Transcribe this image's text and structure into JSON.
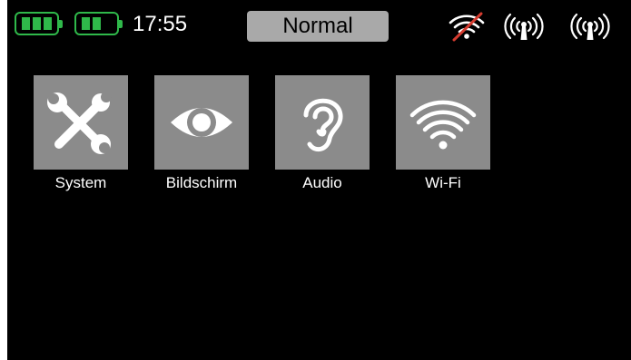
{
  "status": {
    "battery_icons": [
      "battery-icon",
      "battery-icon"
    ],
    "time": "17:55",
    "mode": "Normal",
    "signal_icons": [
      "wifi-disabled-icon",
      "antenna-signal-icon",
      "antenna-signal-icon"
    ]
  },
  "menu": {
    "items": [
      {
        "label": "System",
        "icon": "tools-icon"
      },
      {
        "label": "Bildschirm",
        "icon": "eye-icon"
      },
      {
        "label": "Audio",
        "icon": "ear-icon"
      },
      {
        "label": "Wi-Fi",
        "icon": "wifi-icon"
      }
    ]
  },
  "colors": {
    "background": "#000000",
    "tile": "#8b8b8b",
    "battery": "#2fb84a",
    "mode_pill": "#a9a9a9",
    "wifi_disabled_slash": "#d43b2f"
  }
}
